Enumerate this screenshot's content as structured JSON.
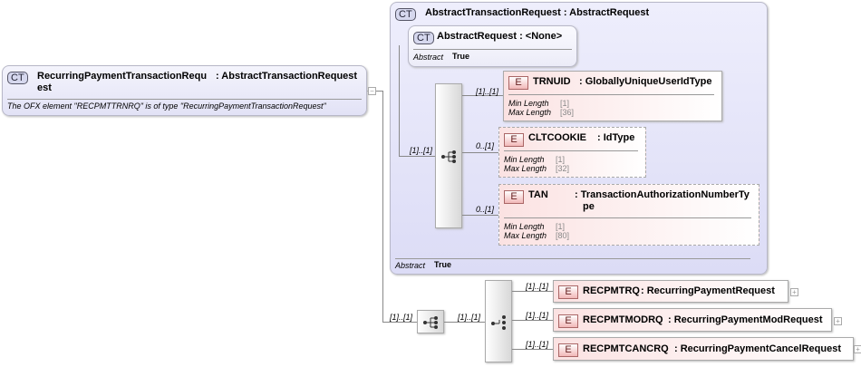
{
  "root": {
    "badge": "CT",
    "name": "RecurringPaymentTransactionRequ",
    "name2": "est",
    "type": ": AbstractTransactionRequest",
    "description": "The OFX element \"RECPMTTRNRQ\" is of type \"RecurringPaymentTransactionRequest\""
  },
  "base": {
    "badge": "CT",
    "title": "AbstractTransactionRequest : AbstractRequest",
    "abstract_label": "Abstract",
    "abstract_value": "True",
    "parent": {
      "badge": "CT",
      "title": "AbstractRequest : <None>",
      "abstract_label": "Abstract",
      "abstract_value": "True"
    },
    "seq_card": "[1]..[1]",
    "elements": [
      {
        "badge": "E",
        "name": "TRNUID",
        "type": ": GloballyUniqueUserIdType",
        "card": "[1]..[1]",
        "min_label": "Min Length",
        "min": "[1]",
        "max_label": "Max Length",
        "max": "[36]"
      },
      {
        "badge": "E",
        "name": "CLTCOOKIE",
        "type": ": IdType",
        "card": "0..[1]",
        "min_label": "Min Length",
        "min": "[1]",
        "max_label": "Max Length",
        "max": "[32]"
      },
      {
        "badge": "E",
        "name": "TAN",
        "type": ": TransactionAuthorizationNumberTy",
        "type2": "pe",
        "card": "0..[1]",
        "min_label": "Min Length",
        "min": "[1]",
        "max_label": "Max Length",
        "max": "[80]"
      }
    ]
  },
  "ext": {
    "seq_card": "[1]..[1]",
    "choice_card": "[1]..[1]",
    "elements": [
      {
        "badge": "E",
        "name": "RECPMTRQ",
        "type": ": RecurringPaymentRequest",
        "card": "[1]..[1]"
      },
      {
        "badge": "E",
        "name": "RECPMTMODRQ",
        "type": ": RecurringPaymentModRequest",
        "card": "[1]..[1]"
      },
      {
        "badge": "E",
        "name": "RECPMTCANCRQ",
        "type": ": RecurringPaymentCancelRequest",
        "card": "[1]..[1]"
      }
    ]
  },
  "expand": "+",
  "collapse": "−"
}
